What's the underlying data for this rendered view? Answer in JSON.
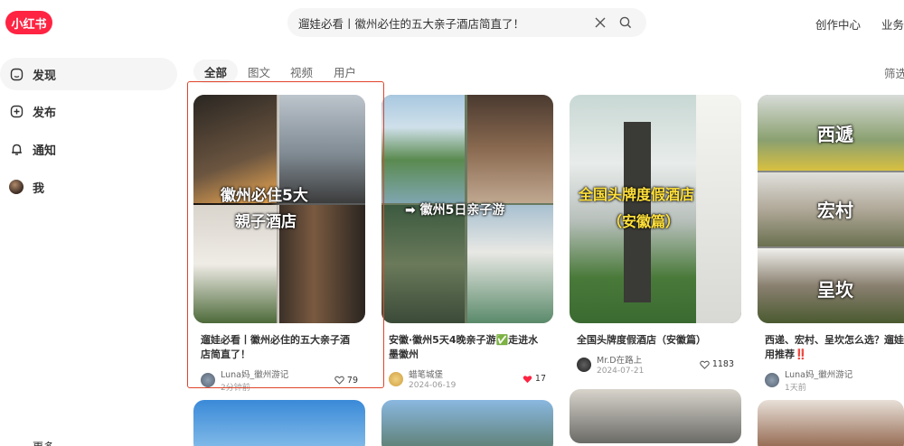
{
  "header": {
    "logo": "小红书",
    "search_value": "遛娃必看丨徽州必住的五大亲子酒店简直了！",
    "links": [
      "创作中心",
      "业务合作"
    ]
  },
  "sidebar": {
    "items": [
      {
        "label": "发现",
        "icon": "home-icon"
      },
      {
        "label": "发布",
        "icon": "plus-square-icon"
      },
      {
        "label": "通知",
        "icon": "bell-icon"
      },
      {
        "label": "我",
        "icon": "avatar"
      }
    ],
    "more": "更多"
  },
  "tabs": [
    "全部",
    "图文",
    "视频",
    "用户"
  ],
  "filter": "筛选",
  "cards": [
    {
      "title": "遛娃必看丨徽州必住的五大亲子酒店简直了！",
      "author": "Luna妈_徽州游记",
      "time": "2分钟前",
      "likes": "79",
      "liked": false,
      "cover_lines": [
        "徽州必住5大",
        "親子酒店"
      ]
    },
    {
      "title": "安徽·徽州5天4晚亲子游✅走进水墨徽州",
      "author": "蜡笔城堡",
      "time": "2024-06-19",
      "likes": "17",
      "liked": true,
      "cover_lines": [
        "➡ 徽州5日亲子游"
      ]
    },
    {
      "title": "全国头牌度假酒店（安徽篇）",
      "author": "Mr.D在路上",
      "time": "2024-07-21",
      "likes": "1183",
      "liked": false,
      "cover_lines": [
        "全国头牌度假酒店",
        "（安徽篇）"
      ]
    },
    {
      "title": "西递、宏村、呈坎怎么选？遛娃实用推荐‼️",
      "author": "Luna妈_徽州游记",
      "time": "1天前",
      "likes": "",
      "liked": false,
      "cover_lines": [
        "西遞",
        "宏村",
        "呈坎"
      ]
    }
  ],
  "colors": {
    "brand": "#ff2442",
    "selection": "#e0442a",
    "liked": "#ff2442"
  }
}
